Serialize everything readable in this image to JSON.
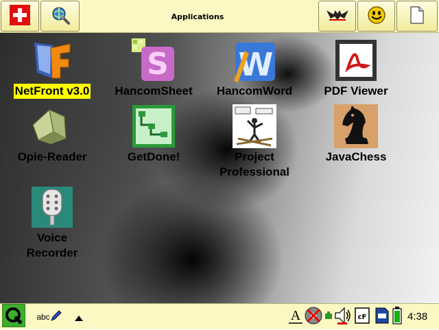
{
  "topbar": {
    "title": "Applications"
  },
  "apps": [
    {
      "label": "NetFront v3.0",
      "icon": "netfront-icon",
      "selected": true
    },
    {
      "label": "HancomSheet",
      "icon": "hancomsheet-icon"
    },
    {
      "label": "HancomWord",
      "icon": "hancomword-icon"
    },
    {
      "label": "PDF Viewer",
      "icon": "pdf-viewer-icon"
    },
    {
      "label": "Opie-Reader",
      "icon": "book-icon"
    },
    {
      "label": "GetDone!",
      "icon": "getdone-icon"
    },
    {
      "label": "Project\nProfessional",
      "icon": "project-professional-icon"
    },
    {
      "label": "JavaChess",
      "icon": "chess-knight-icon"
    },
    {
      "label": "Voice\nRecorder",
      "icon": "microphone-icon"
    }
  ],
  "bottombar": {
    "keyboard_label": "abc",
    "clock": "4:38",
    "storage_cf": "cF"
  },
  "colors": {
    "bar_bg": "#fbf8c4",
    "selection": "#ffff00"
  }
}
